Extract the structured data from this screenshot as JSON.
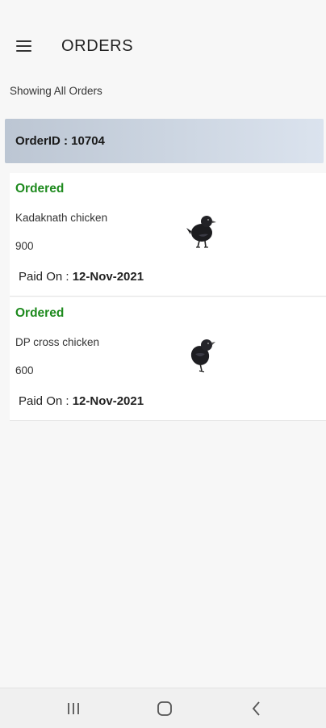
{
  "appbar": {
    "title": "ORDERS",
    "menu_icon": "hamburger-menu-icon"
  },
  "subtitle": "Showing All Orders",
  "order": {
    "id_label": "OrderID : 10704",
    "items": [
      {
        "status": "Ordered",
        "name": "Kadaknath chicken",
        "price": "900",
        "paid_label": "Paid On : ",
        "paid_date": "12-Nov-2021",
        "image_icon": "black-chicken-image"
      },
      {
        "status": "Ordered",
        "name": "DP cross chicken",
        "price": "600",
        "paid_label": "Paid On : ",
        "paid_date": "12-Nov-2021",
        "image_icon": "black-chicken-image"
      }
    ]
  },
  "colors": {
    "status_green": "#1e8a1e",
    "header_gradient_start": "#bcc6d3",
    "header_gradient_end": "#dbe3ee"
  },
  "navbar": {
    "recents_icon": "recents-icon",
    "home_icon": "home-icon",
    "back_icon": "back-icon"
  }
}
